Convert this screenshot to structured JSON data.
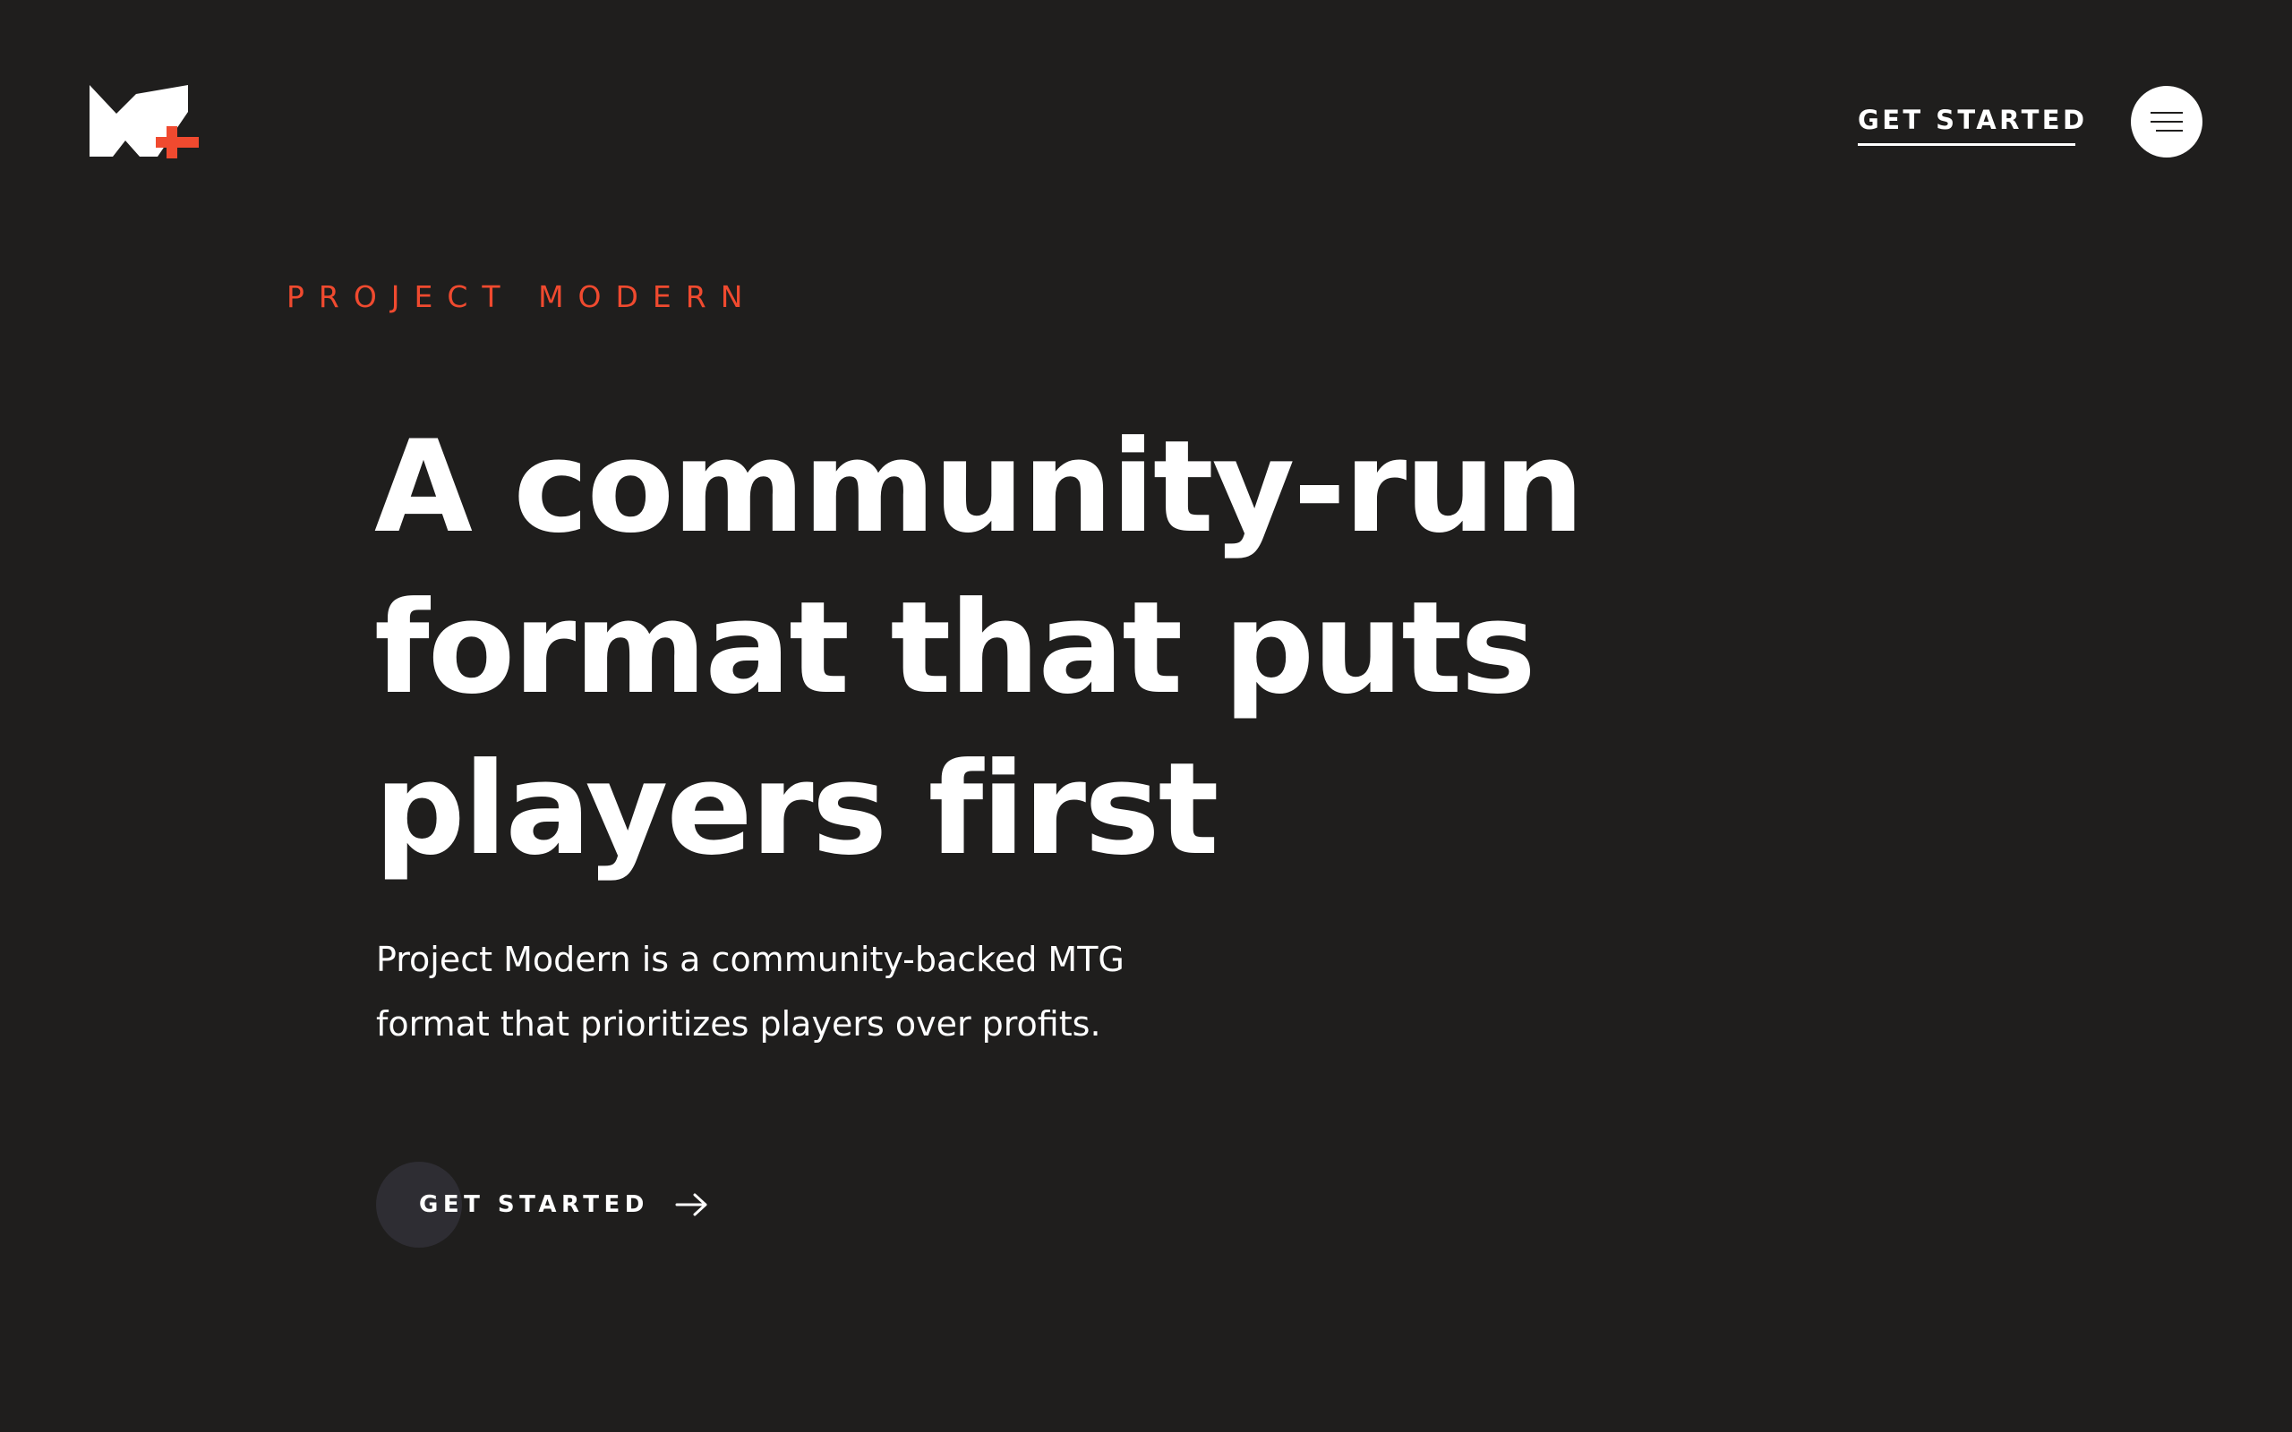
{
  "header": {
    "logo_icon": "m-plus-logo-icon",
    "cta_label": "GET STARTED",
    "menu_icon": "hamburger-menu-icon"
  },
  "hero": {
    "eyebrow": "PROJECT MODERN",
    "headline_lines": [
      "A community-run",
      "format that puts",
      "players first"
    ],
    "subtext_lines": [
      "Project Modern is a community-backed MTG",
      "format that prioritizes players over profits."
    ],
    "cta_label": "GET STARTED",
    "cta_icon": "arrow-right-icon"
  },
  "colors": {
    "background": "#1f1e1d",
    "accent": "#f04a2f",
    "text": "#ffffff",
    "cta_circle": "#2e2d33"
  }
}
